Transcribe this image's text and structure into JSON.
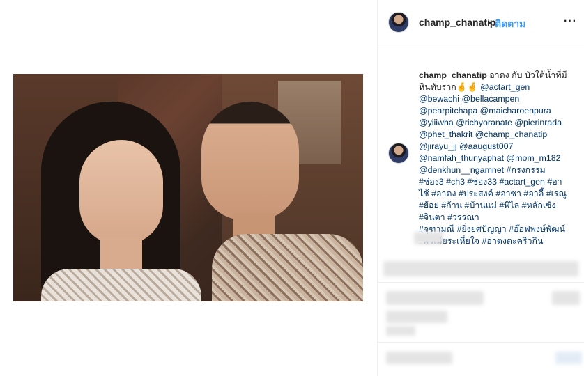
{
  "post": {
    "username": "champ_chanatip",
    "separator": "•",
    "follow_label": "ติดตาม",
    "more_label": "···",
    "caption": {
      "username": "champ_chanatip",
      "lines": [
        " อาตง กับ บัวใต้น้ำที่มี",
        "หินทับราก",
        "@bewachi @bellacampen",
        "@pearpitchapa @maicharoenpura",
        "@yiiiwha @richyoranate @pierinrada",
        "@phet_thakrit @champ_chanatip",
        "@jirayu_jj @aaugust007",
        "@namfah_thunyaphat @mom_m182",
        "@denkhun__ngamnet #กรงกรรม",
        "#ช่อง3 #ch3 #ช่อง33 #actart_gen #อา",
        "ไช้ #อาตง #ประสงค์ #อาซา #อาลี้ #เรณู",
        "#ย้อย #ก้าน #บ้านแม่ #พิไล #หลักเซ้ง",
        "#จินตา #วรรณา",
        "#จุฑามณี #ยิ่งยศปัญญา #อ๊อฟพงษ์พัฒน์",
        "#ผัวเมียระเหี่ยใจ #อาตงตะคริวกิน"
      ],
      "emoji": "🤞🤞",
      "first_tag": "@actart_gen"
    }
  },
  "colors": {
    "link": "#003569",
    "follow": "#3897f0",
    "border": "#efefef"
  }
}
